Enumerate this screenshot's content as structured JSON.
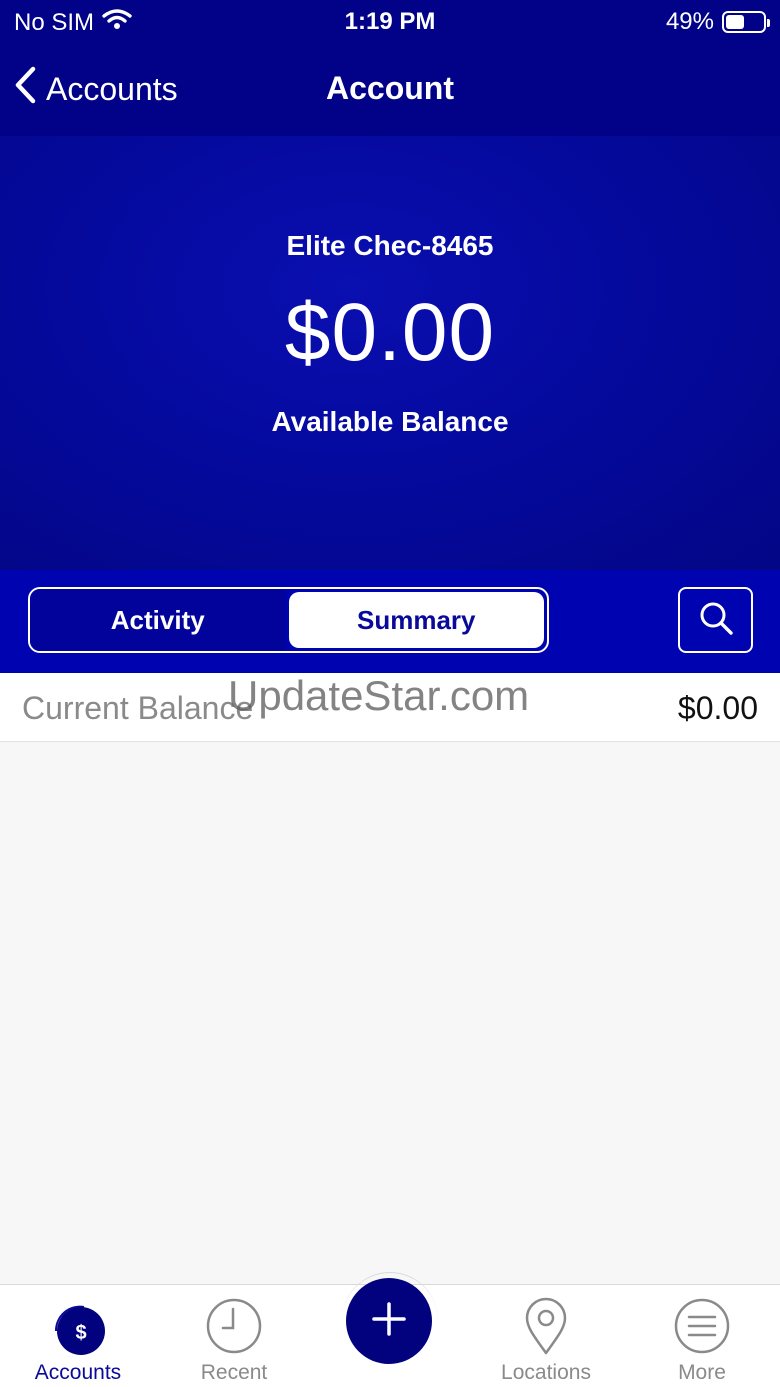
{
  "status_bar": {
    "carrier": "No SIM",
    "time": "1:19 PM",
    "battery": "49%"
  },
  "nav": {
    "back_label": "Accounts",
    "title": "Account"
  },
  "account": {
    "name": "Elite Chec-8465",
    "balance": "$0.00",
    "balance_label": "Available Balance"
  },
  "segments": {
    "activity": "Activity",
    "summary": "Summary",
    "selected": "Summary"
  },
  "summary_rows": [
    {
      "label": "Current Balance",
      "value": "$0.00"
    }
  ],
  "watermark": "UpdateStar.com",
  "tabbar": {
    "items": [
      {
        "label": "Accounts",
        "icon": "accounts-dollar-icon"
      },
      {
        "label": "Recent",
        "icon": "clock-icon"
      },
      {
        "label": "",
        "icon": "plus-icon"
      },
      {
        "label": "Locations",
        "icon": "location-pin-icon"
      },
      {
        "label": "More",
        "icon": "menu-icon"
      }
    ],
    "active": "Accounts"
  },
  "colors": {
    "primary": "#010288",
    "hero": "#050aa0",
    "accent": "#0a0a9a"
  }
}
